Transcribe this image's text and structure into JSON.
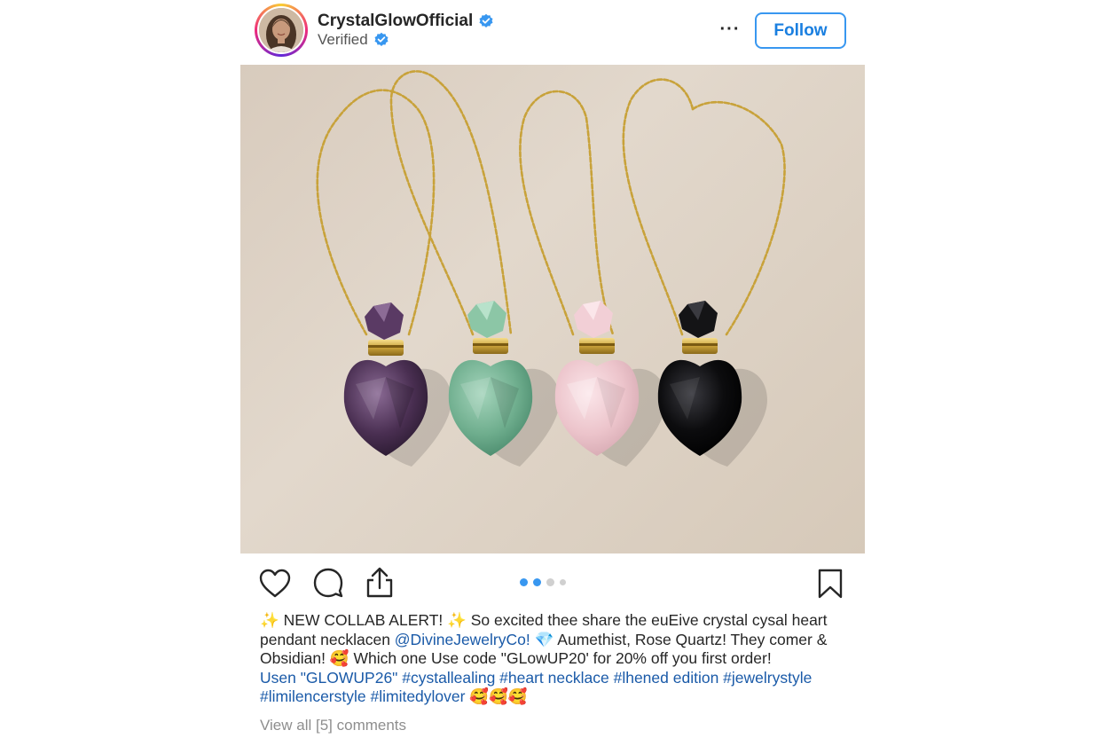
{
  "header": {
    "username": "CrystalGlowOfficial",
    "subtitle": "Verified",
    "more_label": "···",
    "follow_label": "Follow"
  },
  "colors": {
    "accent": "#3897f0",
    "link": "#1a5aa8",
    "text": "#262626",
    "muted": "#8e8e8e"
  },
  "actions": {
    "icons": [
      "heart-icon",
      "comment-icon",
      "share-icon",
      "bookmark-icon"
    ],
    "carousel_total": 4,
    "carousel_active": 2
  },
  "photo": {
    "pendants": [
      "Amethist",
      "Aventurine",
      "Rose Quartz",
      "Obsidian"
    ],
    "colors": [
      "#4a2f52",
      "#6fae8e",
      "#ecc4cb",
      "#0c0c0e"
    ]
  },
  "caption": {
    "line1": {
      "t1": "✨ NEW COLLAB ALERT! ✨ So excited thee share the euEive crystal cysal heart"
    },
    "line2": {
      "t1": "pendant necklacen ",
      "link1": "@DivineJewelryCo!",
      "t2": " 💎 Aumethist, Rose Quartz! They comer  &"
    },
    "line3": {
      "t1": "Obsidian! 🥰 Which one Use code \"GLowUP20' for 20% off you first order!"
    },
    "line4": {
      "link1": "Usen \"GLOWUP26\" #cystallealing #heart necklace #lhened edition #jewelrystyle"
    },
    "line5": {
      "link1": "#limilencerstyle #limitedylover",
      "t1": " 🥰🥰🥰"
    }
  },
  "comments": {
    "label": "View all [5] comments"
  }
}
